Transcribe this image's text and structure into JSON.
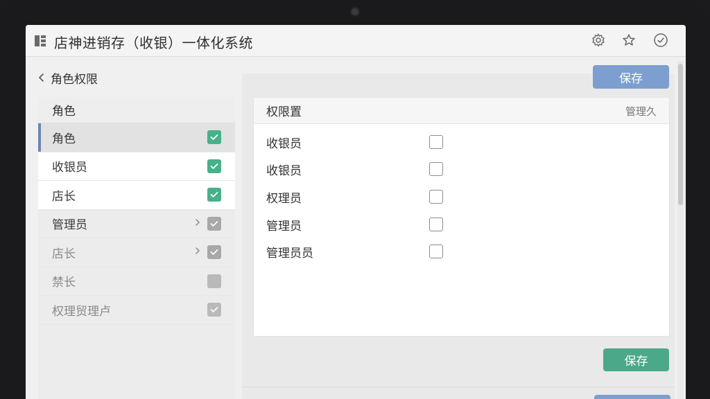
{
  "app": {
    "title": "店神进销存（收银）一体化系统"
  },
  "breadcrumb": {
    "label": "角色权限"
  },
  "roles": {
    "header": "角色",
    "items": [
      {
        "label": "角色",
        "checked": true
      },
      {
        "label": "收银员",
        "checked": true
      },
      {
        "label": "店长",
        "checked": true
      },
      {
        "label": "管理员",
        "checked": true
      },
      {
        "label": "店长",
        "checked": true
      },
      {
        "label": "禁长",
        "checked": false
      },
      {
        "label": "权理贸理卢",
        "checked": true
      }
    ]
  },
  "permissions": {
    "header": "权限置",
    "header_right": "管理久",
    "items": [
      {
        "label": "收银员",
        "checked": false
      },
      {
        "label": "收银员",
        "checked": false
      },
      {
        "label": "权理员",
        "checked": false
      },
      {
        "label": "管理员",
        "checked": false
      },
      {
        "label": "管理员员",
        "checked": false
      }
    ]
  },
  "buttons": {
    "save_top": "保存",
    "save_bottom": "保存"
  },
  "colors": {
    "accent_blue": "#7d9fcf",
    "accent_green": "#4ba889",
    "selected_bar": "#6b86b2"
  },
  "icons": {
    "title_bar": [
      "gear-icon",
      "star-icon",
      "check-circle-icon"
    ],
    "app": "grid-icon",
    "back": "chevron-left-icon"
  }
}
